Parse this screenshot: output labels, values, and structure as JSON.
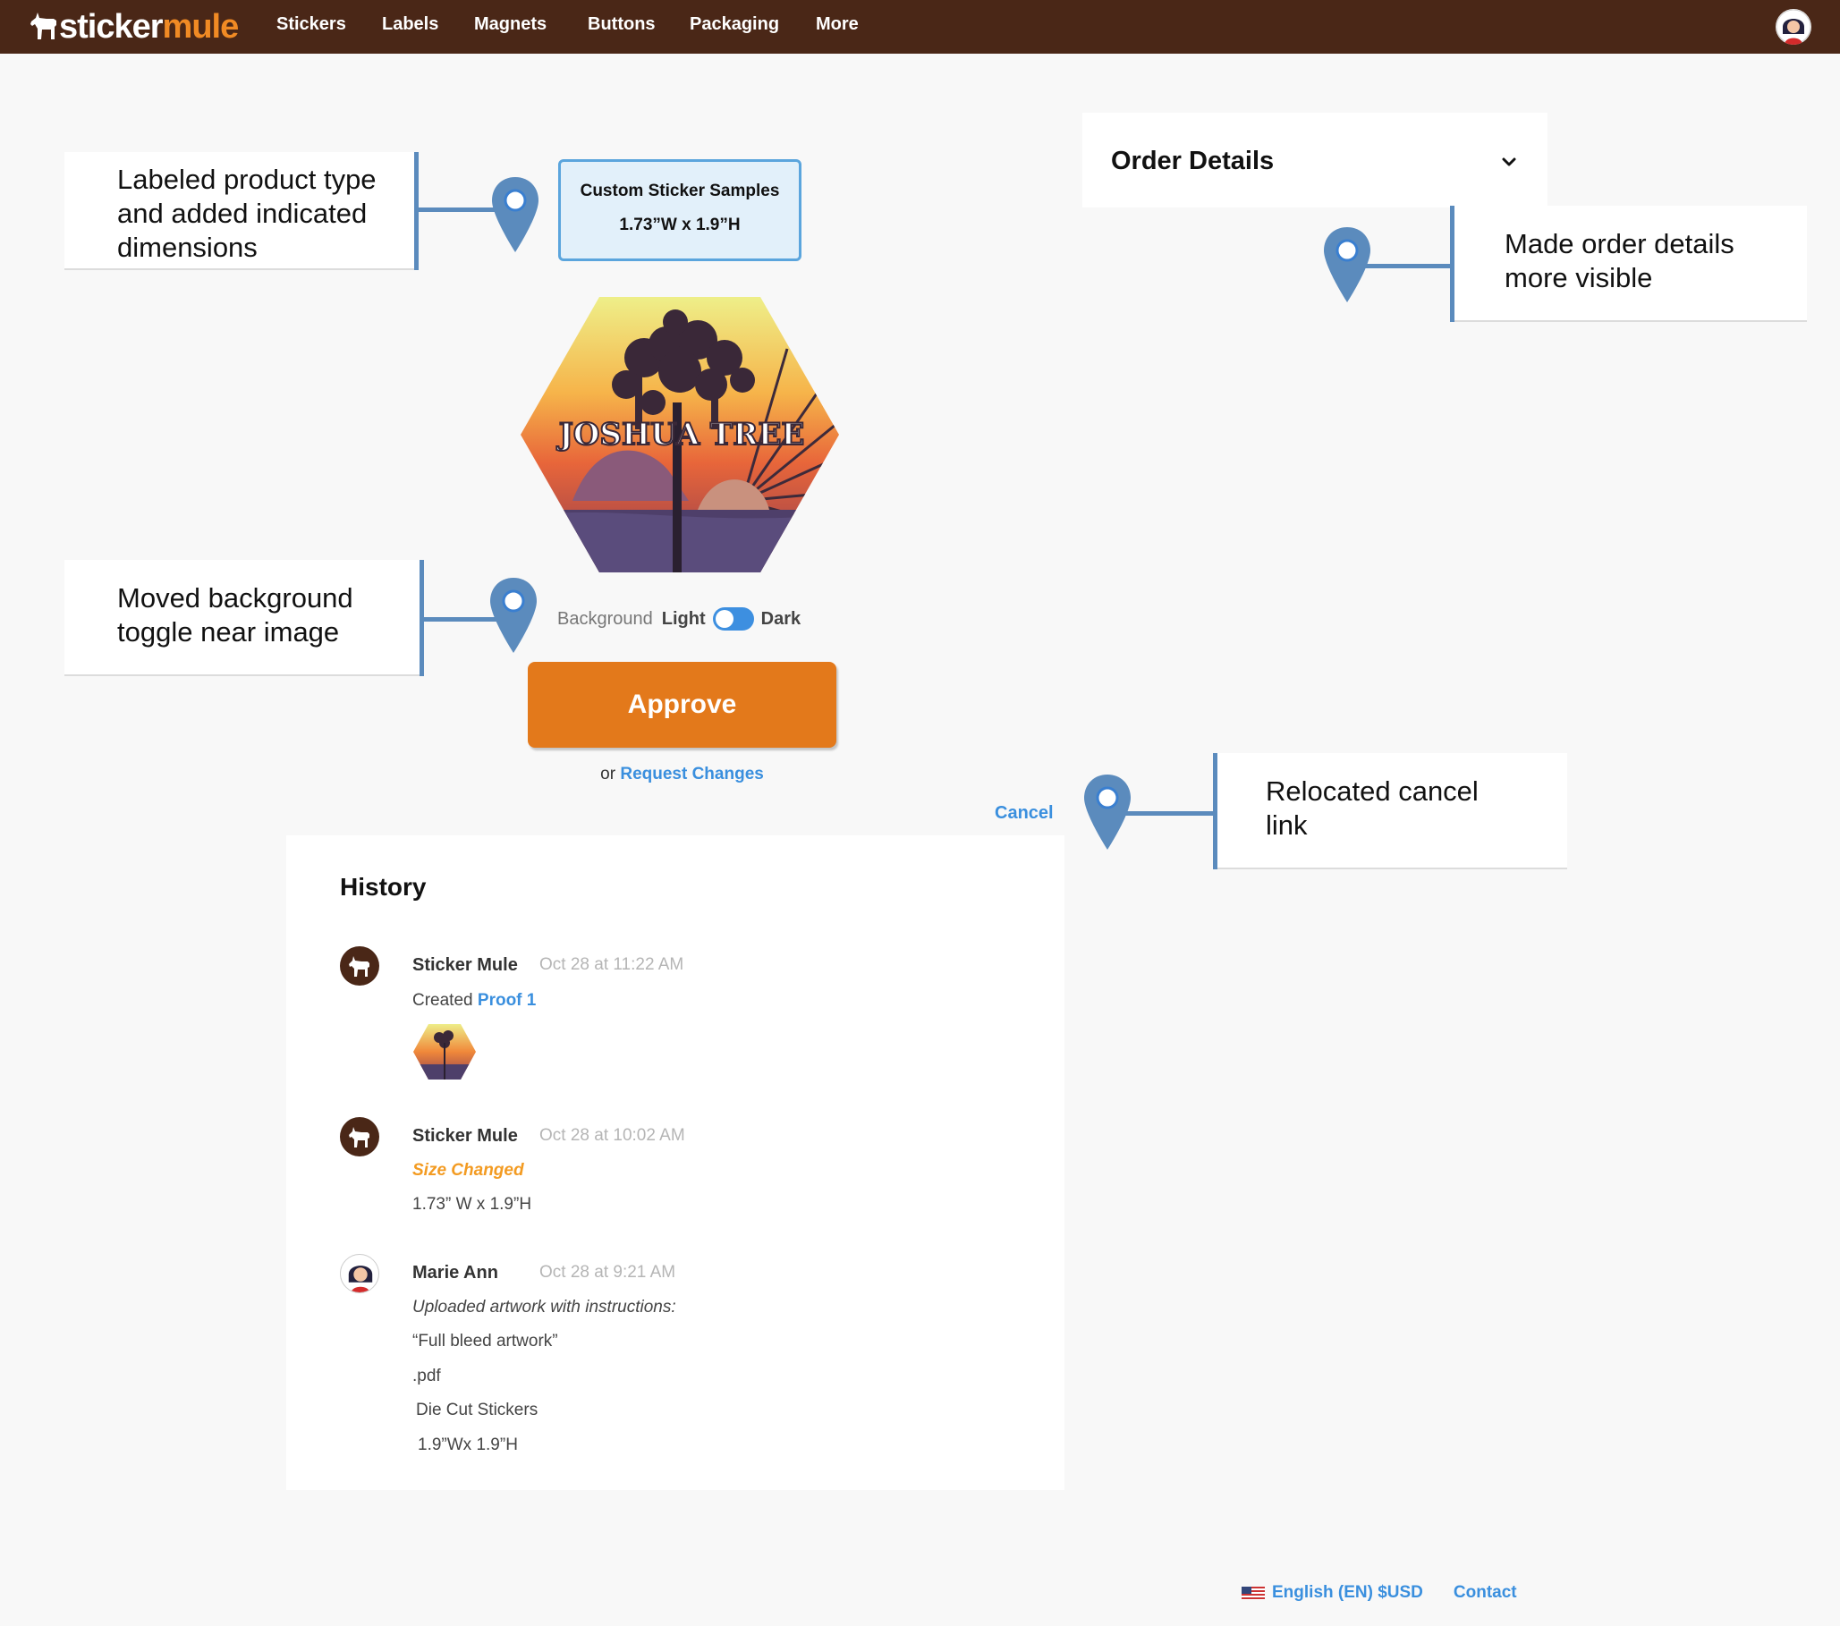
{
  "nav": {
    "logo_part1": "sticker",
    "logo_part2": "mule",
    "items": [
      "Stickers",
      "Labels",
      "Magnets",
      "Buttons",
      "Packaging",
      "More"
    ]
  },
  "callouts": {
    "product_type": [
      "Labeled product type",
      "and added indicated",
      "dimensions"
    ],
    "order_details": [
      "Made order details",
      "more visible"
    ],
    "background_toggle": [
      "Moved background",
      "toggle near image"
    ],
    "cancel": [
      "Relocated cancel",
      "link"
    ]
  },
  "product": {
    "type": "Custom Sticker Samples",
    "dimensions": "1.73”W x 1.9”H",
    "artwork_text": "JOSHUA TREE"
  },
  "background_toggle": {
    "label": "Background",
    "light": "Light",
    "dark": "Dark",
    "state": "light"
  },
  "actions": {
    "approve": "Approve",
    "or": "or",
    "request_changes": "Request Changes",
    "cancel": "Cancel"
  },
  "order_details": {
    "title": "Order Details"
  },
  "history": {
    "title": "History",
    "entries": [
      {
        "author": "Sticker Mule",
        "time": "Oct 28 at 11:22 AM",
        "text_prefix": "Created",
        "link": "Proof 1"
      },
      {
        "author": "Sticker Mule",
        "time": "Oct 28 at 10:02 AM",
        "status": "Size Changed",
        "detail": "1.73” W x 1.9”H"
      },
      {
        "author": "Marie Ann",
        "time": "Oct 28 at 9:21 AM",
        "lines": [
          "Uploaded artwork with instructions:",
          "“Full bleed artwork”",
          ".pdf",
          "Die Cut Stickers",
          "1.9”Wx 1.9”H"
        ]
      }
    ]
  },
  "footer": {
    "language": "English (EN) $USD",
    "contact": "Contact"
  },
  "colors": {
    "nav_bg": "#4a2717",
    "brand_orange": "#e3791b",
    "link_blue": "#3a8fde",
    "callout_blue": "#5b8bbd"
  }
}
